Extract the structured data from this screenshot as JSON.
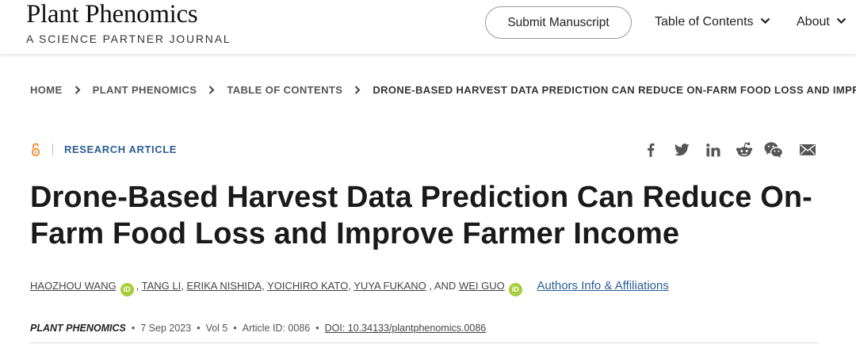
{
  "header": {
    "brand_name": "Plant Phenomics",
    "brand_sub": "A SCIENCE PARTNER JOURNAL",
    "submit_label": "Submit Manuscript",
    "nav": {
      "toc_label": "Table of Contents",
      "about_label": "About"
    }
  },
  "breadcrumb": [
    "HOME",
    "PLANT PHENOMICS",
    "TABLE OF CONTENTS",
    "DRONE-BASED HARVEST DATA PREDICTION CAN REDUCE ON-FARM FOOD LOSS AND IMPROVE..."
  ],
  "article": {
    "type": "RESEARCH ARTICLE",
    "open_access_icon": "open-access-icon",
    "title": "Drone-Based Harvest Data Prediction Can Reduce On-Farm Food Loss and Improve Farmer Income",
    "share_icons": [
      "facebook-icon",
      "twitter-icon",
      "linkedin-icon",
      "reddit-icon",
      "wechat-icon",
      "email-icon"
    ],
    "authors": {
      "a1": "HAOZHOU WANG",
      "a2": "TANG LI",
      "a3": "ERIKA NISHIDA",
      "a4": "YOICHIRO KATO",
      "a5": "YUYA FUKANO",
      "a6": "WEI GUO",
      "comma": ",",
      "and": ", AND",
      "orcid_label": "iD",
      "affiliations_link": "Authors Info & Affiliations"
    },
    "pub": {
      "journal": "PLANT PHENOMICS",
      "date": "7 Sep 2023",
      "volume": "Vol 5",
      "article_id": "Article ID: 0086",
      "doi": "DOI: 10.34133/plantphenomics.0086",
      "sep": "•"
    }
  },
  "colors": {
    "accent_blue": "#2a5d93",
    "orcid_green": "#a6ce39",
    "open_access_orange": "#f58220"
  }
}
